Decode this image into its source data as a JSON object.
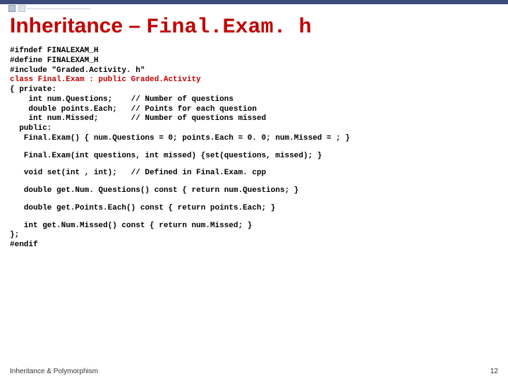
{
  "title": {
    "label_plain": "Inheritance",
    "dash": " – ",
    "label_mono": "Final.Exam. h"
  },
  "code": {
    "l1": "#ifndef FINALEXAM_H",
    "l2": "#define FINALEXAM_H",
    "l3": "#include \"Graded.Activity. h\"",
    "l4_a": "class Final.Exam : public ",
    "l4_b": "Graded.Activity",
    "l5": "{ private:",
    "l6": "    int num.Questions;    // Number of questions",
    "l7": "    double points.Each;   // Points for each question",
    "l8": "    int num.Missed;       // Number of questions missed",
    "l9": "  public:",
    "l10": "   Final.Exam() { num.Questions = 0; points.Each = 0. 0; num.Missed = ; }",
    "l11": "   Final.Exam(int questions, int missed) {set(questions, missed); }",
    "l12": "   void set(int , int);   // Defined in Final.Exam. cpp",
    "l13": "   double get.Num. Questions() const { return num.Questions; }",
    "l14": "   double get.Points.Each() const { return points.Each; }",
    "l15": "   int get.Num.Missed() const { return num.Missed; }",
    "l16": "};",
    "l17": "#endif"
  },
  "footer": {
    "left": "Inheritance & Polymorphism",
    "right": "12"
  }
}
